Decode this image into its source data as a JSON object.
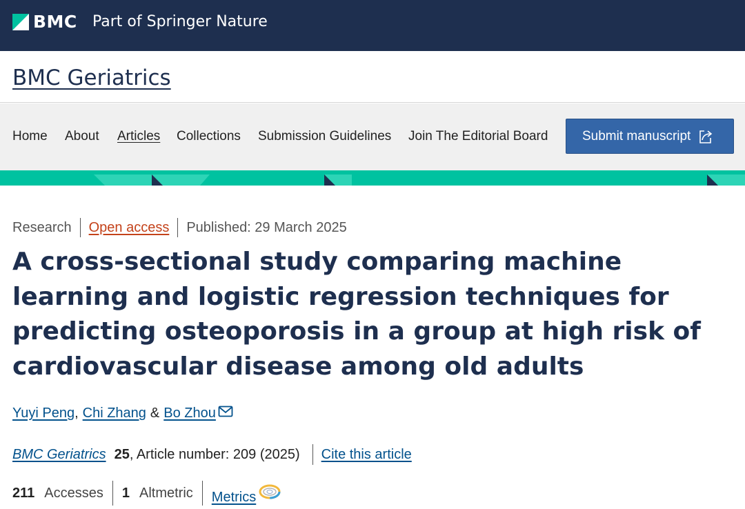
{
  "brand": {
    "logo_text": "BMC",
    "tagline": "Part of Springer Nature"
  },
  "journal": {
    "title": "BMC Geriatrics"
  },
  "nav": {
    "items": [
      {
        "label": "Home"
      },
      {
        "label": "About"
      },
      {
        "label": "Articles"
      },
      {
        "label": "Collections"
      },
      {
        "label": "Submission Guidelines"
      },
      {
        "label": "Join The Editorial Board"
      }
    ],
    "active": "Articles",
    "submit_label": "Submit manuscript",
    "submit_icon": "external-link-icon"
  },
  "colors": {
    "brand_navy": "#1e2f4f",
    "teal": "#00c2a0",
    "link_blue": "#02518c",
    "open_access_orange": "#c4421a",
    "button_blue": "#3466a8"
  },
  "article": {
    "type": "Research",
    "access": "Open access",
    "published": "Published: 29 March 2025",
    "title": "A cross-sectional study comparing machine learning and logistic regression techniques for predicting osteoporosis in a group at high risk of cardiovascular disease among old adults",
    "authors": [
      {
        "name": "Yuyi Peng"
      },
      {
        "name": "Chi Zhang"
      },
      {
        "name": "Bo Zhou"
      }
    ],
    "author_sep_1": ",",
    "author_sep_2": "&",
    "corresponding_icon": "mail-icon",
    "citation": {
      "journal": "BMC Geriatrics",
      "volume": "25",
      "article_number": ", Article number: 209 (2025)",
      "cite_link": "Cite this article"
    },
    "metrics": {
      "accesses_count": "211",
      "accesses_label": "Accesses",
      "altmetric_count": "1",
      "altmetric_label": "Altmetric",
      "metrics_link": "Metrics",
      "metrics_icon": "altmetric-donut-icon"
    }
  }
}
